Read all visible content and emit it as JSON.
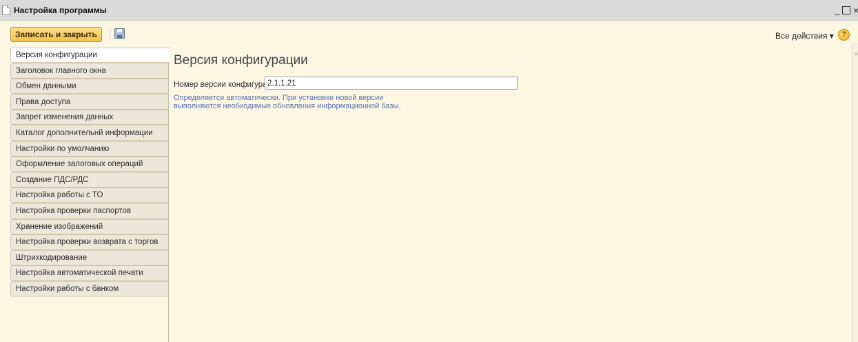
{
  "window": {
    "title": "Настройка программы",
    "controls": {
      "minimize": "_",
      "maximize": "",
      "close": "×"
    }
  },
  "toolbar": {
    "save_close_label": "Записать и закрыть",
    "all_actions_label": "Все действия ▾",
    "help_label": "?"
  },
  "sidebar": {
    "items": [
      {
        "label": "Версия конфигурации",
        "active": true
      },
      {
        "label": "Заголовок главного окна"
      },
      {
        "label": "Обмен данными"
      },
      {
        "label": "Права доступа"
      },
      {
        "label": "Запрет изменения данных"
      },
      {
        "label": "Каталог дополнительнй информации"
      },
      {
        "label": "Настройки по умолчанию"
      },
      {
        "label": "Оформление залоговых операций"
      },
      {
        "label": "Создание ПДС/РДС"
      },
      {
        "label": "Настройка работы с ТО"
      },
      {
        "label": "Настройка проверки паспортов"
      },
      {
        "label": "Хранение изображений"
      },
      {
        "label": "Настройка проверки возврата с торгов"
      },
      {
        "label": "Штрихкодирование"
      },
      {
        "label": "Настройка автоматической печати"
      },
      {
        "label": "Настройки работы с банком"
      }
    ]
  },
  "main": {
    "title": "Версия конфигурации",
    "version_label": "Номер версии конфигурации:",
    "version_value": "2.1.1.21",
    "note_line1": "Определяется автоматически. При установке новой версии",
    "note_line2": "выполняются необходимые обновления информационной базы."
  },
  "colors": {
    "background": "#fbf7e3",
    "accent_button": "#f2c24e",
    "note_text": "#5a6fb4"
  }
}
